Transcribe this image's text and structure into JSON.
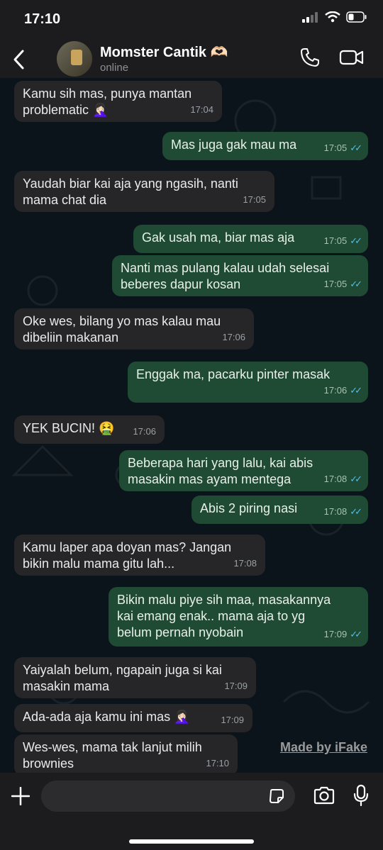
{
  "status_bar": {
    "time": "17:10"
  },
  "header": {
    "name": "Momster Cantik 🫶🏻",
    "status": "online"
  },
  "messages": [
    {
      "dir": "in",
      "text": "Kamu sih mas, punya mantan\nproblematic 🤦🏻‍♀️",
      "time": "17:04"
    },
    {
      "dir": "out",
      "text": "Mas juga gak mau ma",
      "time": "17:05"
    },
    {
      "dir": "in",
      "text": "Yaudah biar kai aja yang ngasih, nanti\nmama chat dia",
      "time": "17:05"
    },
    {
      "dir": "out",
      "text": "Gak usah ma, biar mas aja",
      "time": "17:05"
    },
    {
      "dir": "out",
      "text": "Nanti mas pulang kalau udah selesai\nbeberes dapur kosan",
      "time": "17:05"
    },
    {
      "dir": "in",
      "text": "Oke wes, bilang yo mas kalau mau\ndibeliin makanan",
      "time": "17:06"
    },
    {
      "dir": "out",
      "text": "Enggak ma, pacarku pinter masak",
      "time": "17:06"
    },
    {
      "dir": "in",
      "text": "YEK BUCIN! 🤮",
      "time": "17:06"
    },
    {
      "dir": "out",
      "text": "Beberapa hari yang lalu, kai abis\nmasakin mas ayam mentega",
      "time": "17:08"
    },
    {
      "dir": "out",
      "text": "Abis 2 piring nasi",
      "time": "17:08"
    },
    {
      "dir": "in",
      "text": "Kamu laper apa doyan mas? Jangan\nbikin malu mama gitu lah...",
      "time": "17:08"
    },
    {
      "dir": "out",
      "text": "Bikin malu piye sih maa, masakannya\nkai emang enak.. mama aja to yg\nbelum pernah nyobain",
      "time": "17:09"
    },
    {
      "dir": "in",
      "text": "Yaiyalah belum, ngapain juga si kai\nmasakin mama",
      "time": "17:09"
    },
    {
      "dir": "in",
      "text": "Ada-ada aja kamu ini mas 🤦🏻‍♀️",
      "time": "17:09"
    },
    {
      "dir": "in",
      "text": "Wes-wes, mama tak lanjut milih\nbrownies",
      "time": "17:10"
    }
  ],
  "watermark": "Made by iFake",
  "input": {
    "placeholder": ""
  },
  "colors": {
    "incoming": "#262628",
    "outgoing": "#1f4a33",
    "tick": "#53bdeb"
  }
}
